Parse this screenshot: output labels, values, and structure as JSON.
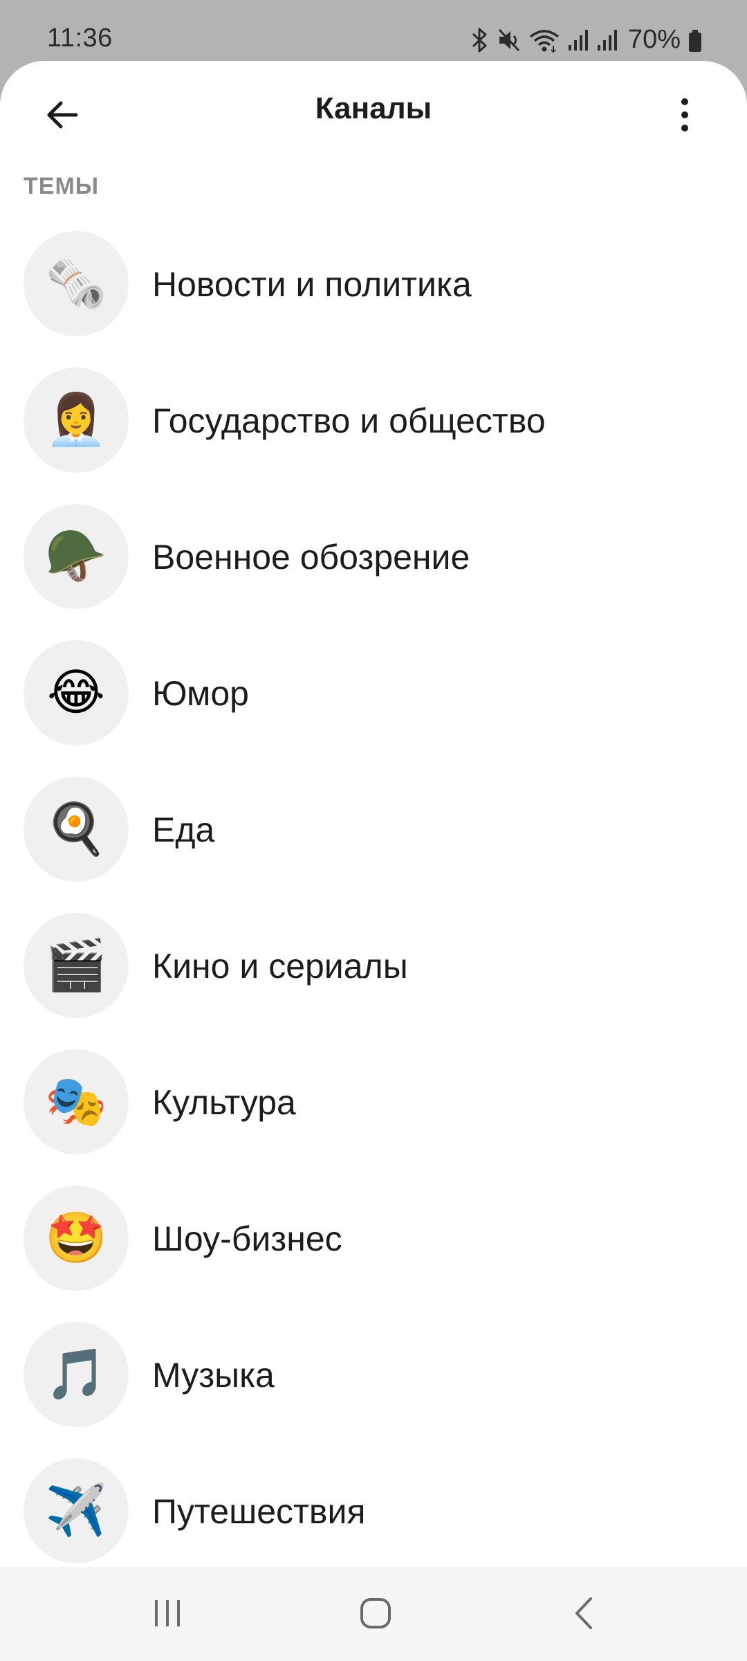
{
  "status_bar": {
    "time": "11:36",
    "battery": "70%",
    "icons": [
      "bluetooth-icon",
      "mute-icon",
      "wifi-icon",
      "signal-icon",
      "signal-icon",
      "battery-icon"
    ]
  },
  "header": {
    "title": "Каналы",
    "back_icon": "arrow-left-icon",
    "menu_icon": "more-vertical-icon"
  },
  "section": {
    "title": "ТЕМЫ"
  },
  "topics": [
    {
      "label": "Новости и политика",
      "emoji": "🗞️",
      "icon": "newspaper-icon"
    },
    {
      "label": "Государство и общество",
      "emoji": "👩‍💼",
      "icon": "office-worker-icon"
    },
    {
      "label": "Военное обозрение",
      "emoji": "🪖",
      "icon": "military-helmet-icon"
    },
    {
      "label": "Юмор",
      "emoji": "😂",
      "icon": "laughing-face-icon"
    },
    {
      "label": "Еда",
      "emoji": "🍳",
      "icon": "frying-pan-icon"
    },
    {
      "label": "Кино и сериалы",
      "emoji": "🎬",
      "icon": "clapper-board-icon"
    },
    {
      "label": "Культура",
      "emoji": "🎭",
      "icon": "theater-masks-icon"
    },
    {
      "label": "Шоу-бизнес",
      "emoji": "🤩",
      "icon": "star-struck-icon"
    },
    {
      "label": "Музыка",
      "emoji": "🎵",
      "icon": "music-note-icon"
    },
    {
      "label": "Путешествия",
      "emoji": "✈️",
      "icon": "airplane-icon"
    }
  ],
  "colors": {
    "background": "#ffffff",
    "statusbar_bg": "#b3b3b3",
    "icon_circle": "#f0f0f0",
    "section_title": "#8a8a8a",
    "text": "#1c1c1c"
  }
}
